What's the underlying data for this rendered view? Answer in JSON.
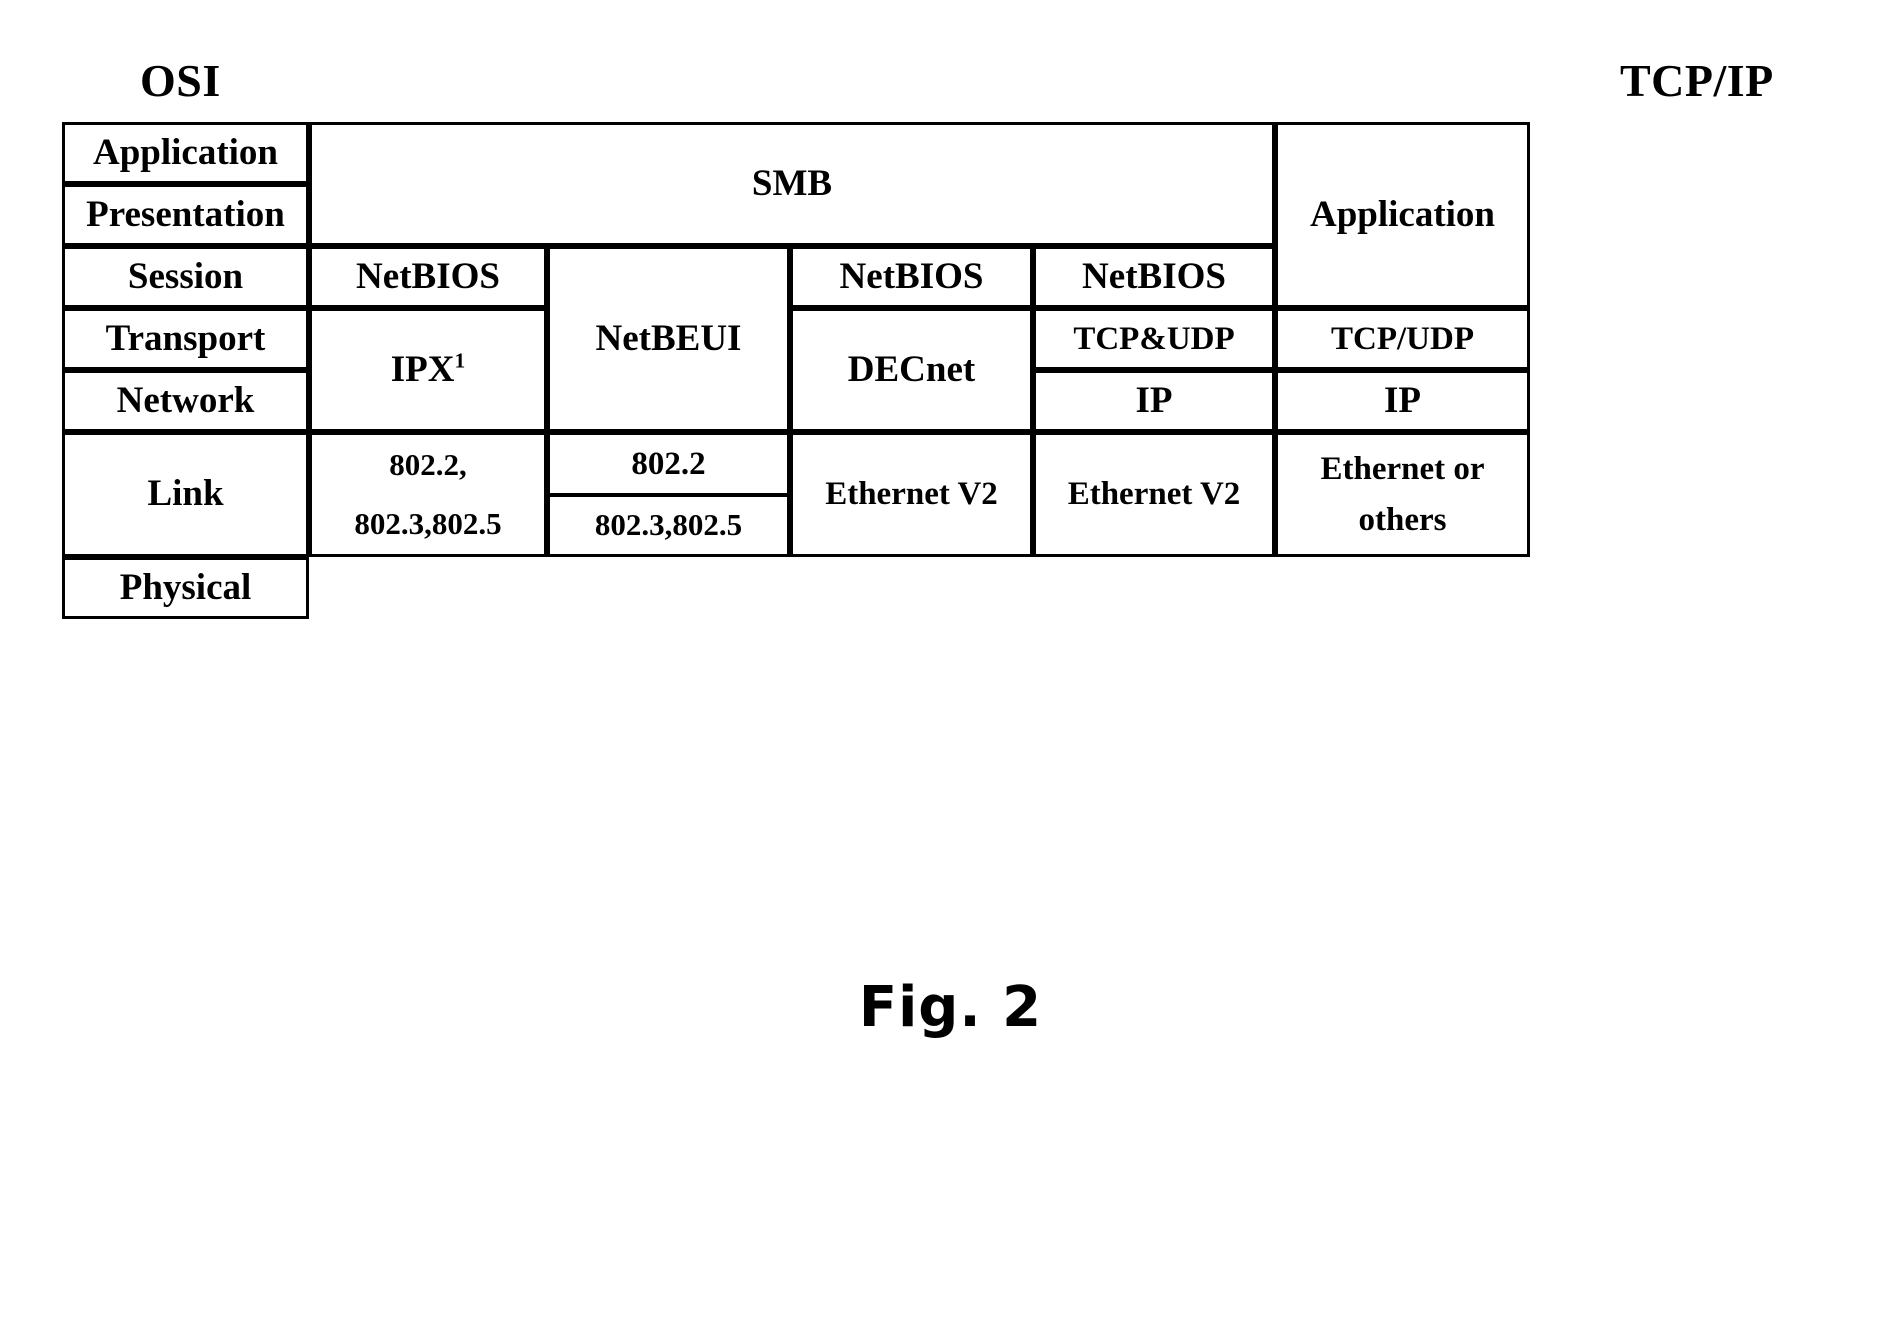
{
  "figure": {
    "caption": "Fig. 2",
    "headers": {
      "left": "OSI",
      "right": "TCP/IP"
    }
  },
  "table": {
    "osi_layers": [
      "Application",
      "Presentation",
      "Session",
      "Transport",
      "Network",
      "Link",
      "Physical"
    ],
    "application_span": "SMB",
    "tcpip_column": {
      "application": "Application",
      "transport": "TCP/UDP",
      "network": "IP",
      "link_line1": "Ethernet or",
      "link_line2": "others"
    },
    "stacks": [
      {
        "name": "ipx-stack",
        "session": "NetBIOS",
        "transport_network": "IPX",
        "transport_network_superscript": "1",
        "link_line1": "802.2,",
        "link_line2": "802.3,802.5"
      },
      {
        "name": "netbeui-stack",
        "session": "",
        "transport_network": "NetBEUI",
        "link_line1": "802.2",
        "link_line2": "802.3,802.5"
      },
      {
        "name": "decnet-stack",
        "session": "NetBIOS",
        "transport_network": "DECnet",
        "link_line1": "Ethernet V2"
      },
      {
        "name": "tcpip-netbios-stack",
        "session": "NetBIOS",
        "transport": "TCP&UDP",
        "network": "IP",
        "link_line1": "Ethernet V2"
      }
    ]
  }
}
